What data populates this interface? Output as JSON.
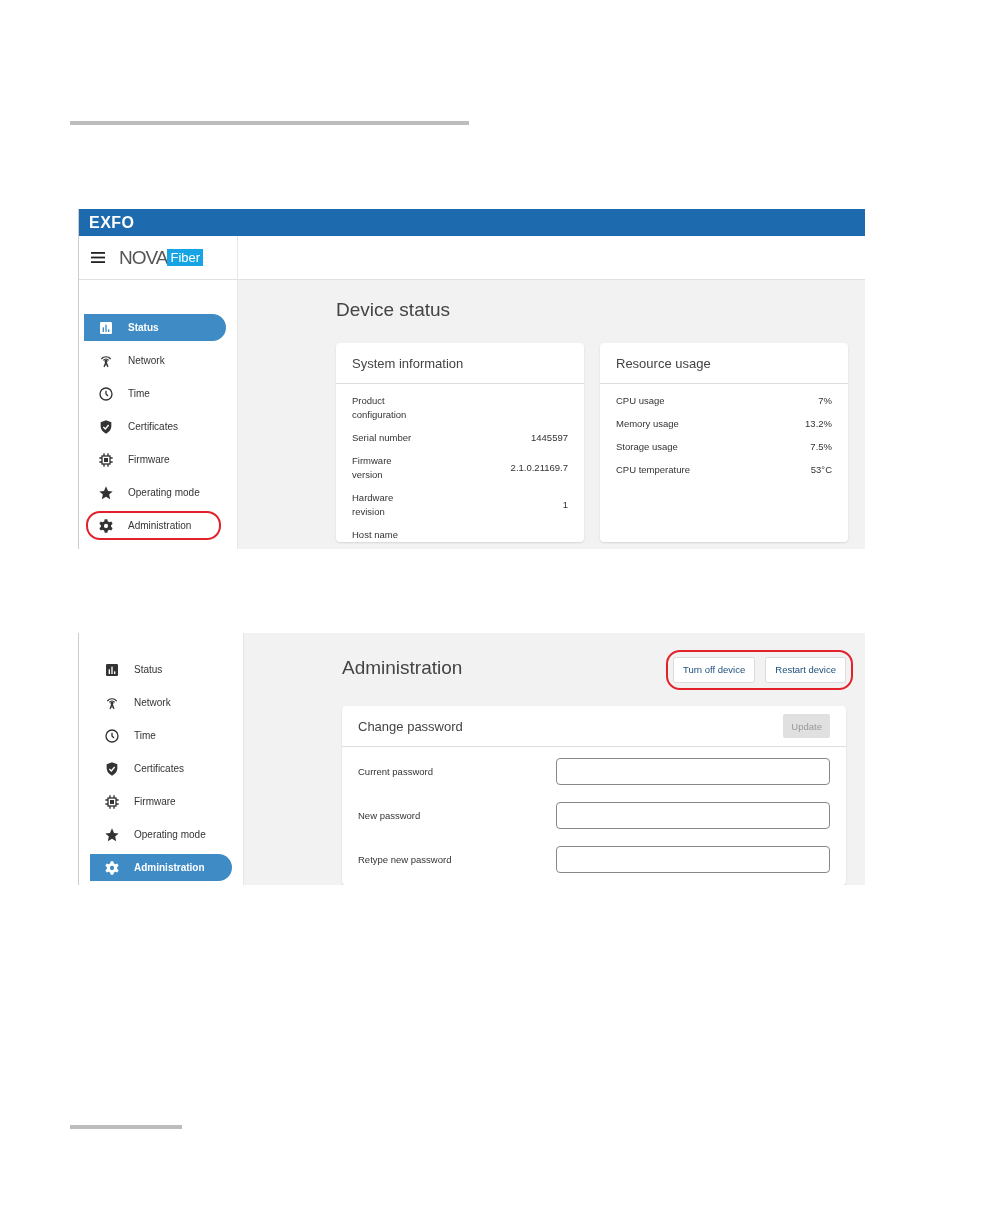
{
  "status_screen": {
    "brand": "EXFO",
    "logo": {
      "word": "NOVA",
      "tag": "Fiber"
    },
    "nav": [
      {
        "label": "Status",
        "selected": true,
        "highlighted": false
      },
      {
        "label": "Network",
        "selected": false,
        "highlighted": false
      },
      {
        "label": "Time",
        "selected": false,
        "highlighted": false
      },
      {
        "label": "Certificates",
        "selected": false,
        "highlighted": false
      },
      {
        "label": "Firmware",
        "selected": false,
        "highlighted": false
      },
      {
        "label": "Operating mode",
        "selected": false,
        "highlighted": false
      },
      {
        "label": "Administration",
        "selected": false,
        "highlighted": true
      }
    ],
    "title": "Device status",
    "cards": [
      {
        "title": "System information",
        "rows": [
          {
            "label": "Product configuration"
          },
          {
            "label": "Serial number",
            "value": "1445597"
          },
          {
            "label": "Firmware version",
            "value": "2.1.0.21169.7"
          },
          {
            "label": "Hardware revision",
            "value": "1"
          },
          {
            "label": "Host name"
          }
        ]
      },
      {
        "title": "Resource usage",
        "rows": [
          {
            "label": "CPU usage",
            "value": "7%"
          },
          {
            "label": "Memory usage",
            "value": "13.2%"
          },
          {
            "label": "Storage usage",
            "value": "7.5%"
          },
          {
            "label": "CPU temperature",
            "value": "53°C"
          }
        ]
      }
    ]
  },
  "admin_screen": {
    "nav": [
      {
        "label": "Status",
        "selected": false
      },
      {
        "label": "Network",
        "selected": false
      },
      {
        "label": "Time",
        "selected": false
      },
      {
        "label": "Certificates",
        "selected": false
      },
      {
        "label": "Firmware",
        "selected": false
      },
      {
        "label": "Operating mode",
        "selected": false
      },
      {
        "label": "Administration",
        "selected": true
      }
    ],
    "title": "Administration",
    "actions_highlighted": true,
    "actions": [
      "Turn off device",
      "Restart device"
    ],
    "card": {
      "title": "Change password",
      "update": {
        "label": "Update",
        "disabled": true
      },
      "fields": [
        {
          "label": "Current password"
        },
        {
          "label": "New password"
        },
        {
          "label": "Retype new password"
        }
      ]
    }
  }
}
